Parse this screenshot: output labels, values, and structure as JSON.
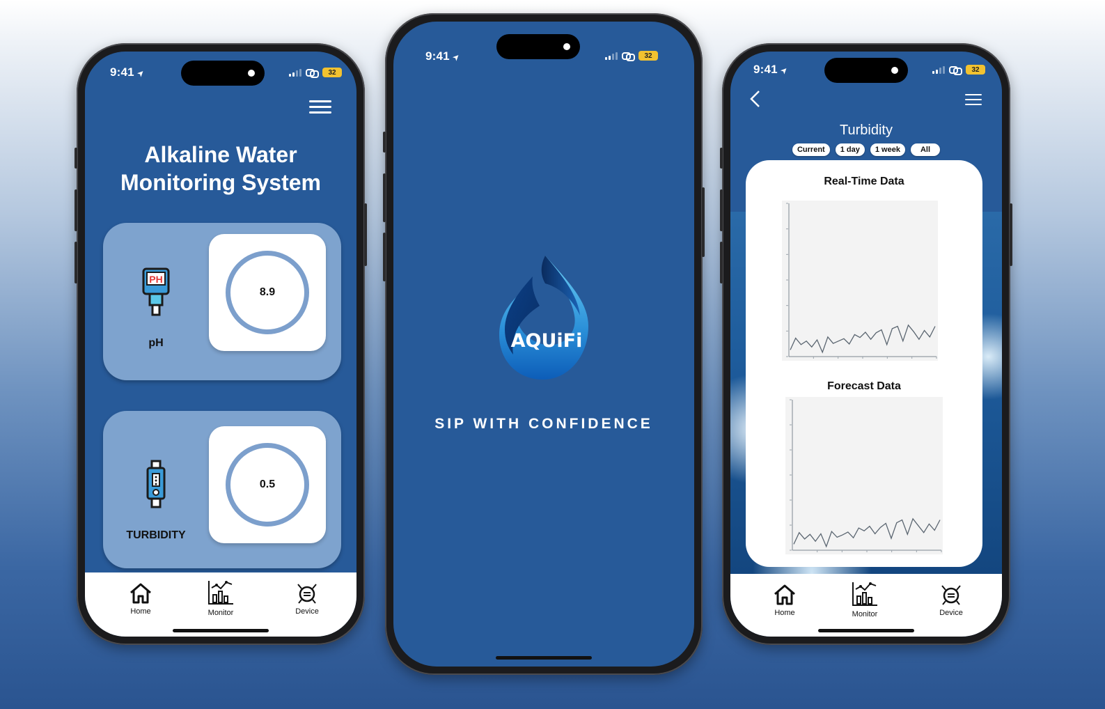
{
  "status": {
    "time": "9:41",
    "battery": "32"
  },
  "phone_home": {
    "title_line1": "Alkaline Water",
    "title_line2": "Monitoring System",
    "cards": [
      {
        "label": "pH",
        "icon": "ph-meter-icon",
        "value": "8.9"
      },
      {
        "label": "TURBIDITY",
        "icon": "turbidity-sensor-icon",
        "value": "0.5"
      }
    ]
  },
  "nav": {
    "home": "Home",
    "monitor": "Monitor",
    "device": "Device"
  },
  "splash": {
    "logo_text": "AQUiFi",
    "tagline": "SIP WITH CONFIDENCE"
  },
  "monitor_screen": {
    "title": "Turbidity",
    "filters": [
      "Current",
      "1 day",
      "1 week",
      "All"
    ],
    "realtime_title": "Real-Time Data",
    "forecast_title": "Forecast Data"
  },
  "chart_data": [
    {
      "type": "line",
      "title": "Real-Time Data",
      "xlabel": "",
      "ylabel": "",
      "y": [
        0.9,
        2.9,
        1.8,
        2.4,
        1.4,
        2.6,
        0.5,
        3.1,
        2.0,
        2.4,
        2.8,
        1.9,
        3.5,
        3.0,
        3.9,
        2.7,
        3.8,
        4.3,
        1.8,
        4.5,
        4.9,
        2.4,
        5.1,
        4.0,
        2.7,
        4.2,
        3.1,
        4.9
      ]
    },
    {
      "type": "line",
      "title": "Forecast Data",
      "xlabel": "",
      "ylabel": "",
      "y": [
        0.8,
        2.8,
        1.7,
        2.5,
        1.3,
        2.6,
        0.4,
        3.0,
        2.0,
        2.4,
        2.9,
        1.9,
        3.6,
        3.1,
        3.9,
        2.6,
        3.7,
        4.4,
        1.8,
        4.5,
        5.0,
        2.5,
        5.2,
        4.0,
        2.8,
        4.3,
        3.2,
        5.0
      ]
    }
  ],
  "colors": {
    "brand_blue": "#275a99",
    "card_blue": "#7ea3ce",
    "ring": "#7c9fcc"
  }
}
